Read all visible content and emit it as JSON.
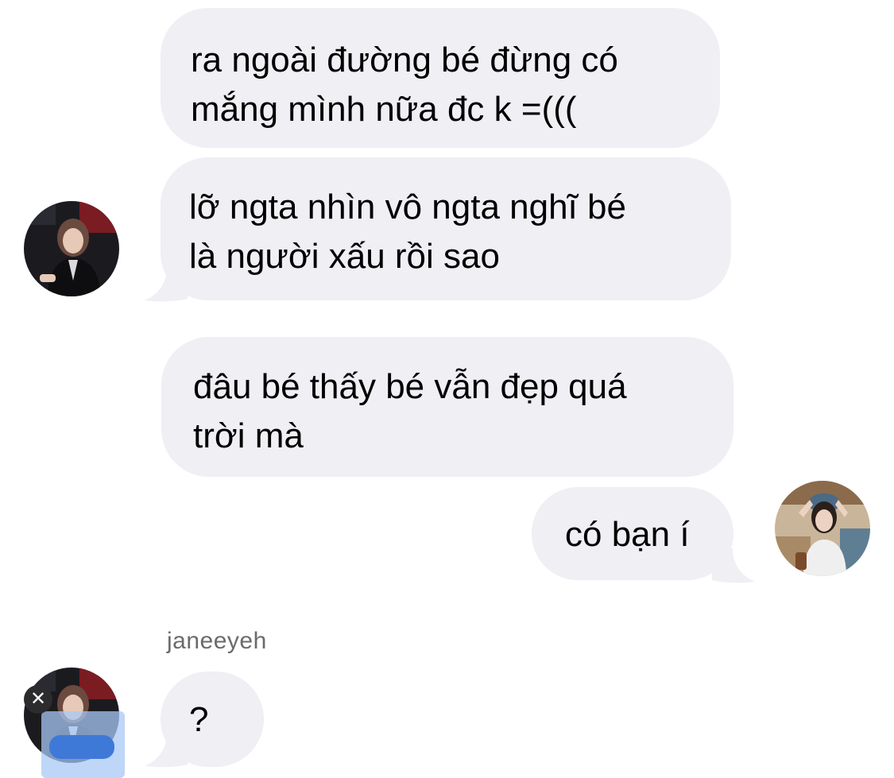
{
  "colors": {
    "bubble_bg": "#efeff4",
    "text": "#000000",
    "sender_name": "#6b6b6b",
    "background": "#ffffff"
  },
  "messages": [
    {
      "text": "ra ngoài đường bé đừng có\nmắng mình nữa đc k =(((",
      "direction": "incoming"
    },
    {
      "text": "lỡ ngta nhìn vô ngta nghĩ bé\nlà người xấu rồi sao",
      "direction": "incoming"
    },
    {
      "text": "đâu bé thấy bé vẫn đẹp quá\ntrời mà",
      "direction": "incoming"
    },
    {
      "text": "có bạn í",
      "direction": "incoming"
    },
    {
      "text": "?",
      "direction": "incoming"
    }
  ],
  "sender": {
    "name": "janeeyeh"
  },
  "icons": {
    "close": "close-icon",
    "close_glyph": "✕"
  }
}
